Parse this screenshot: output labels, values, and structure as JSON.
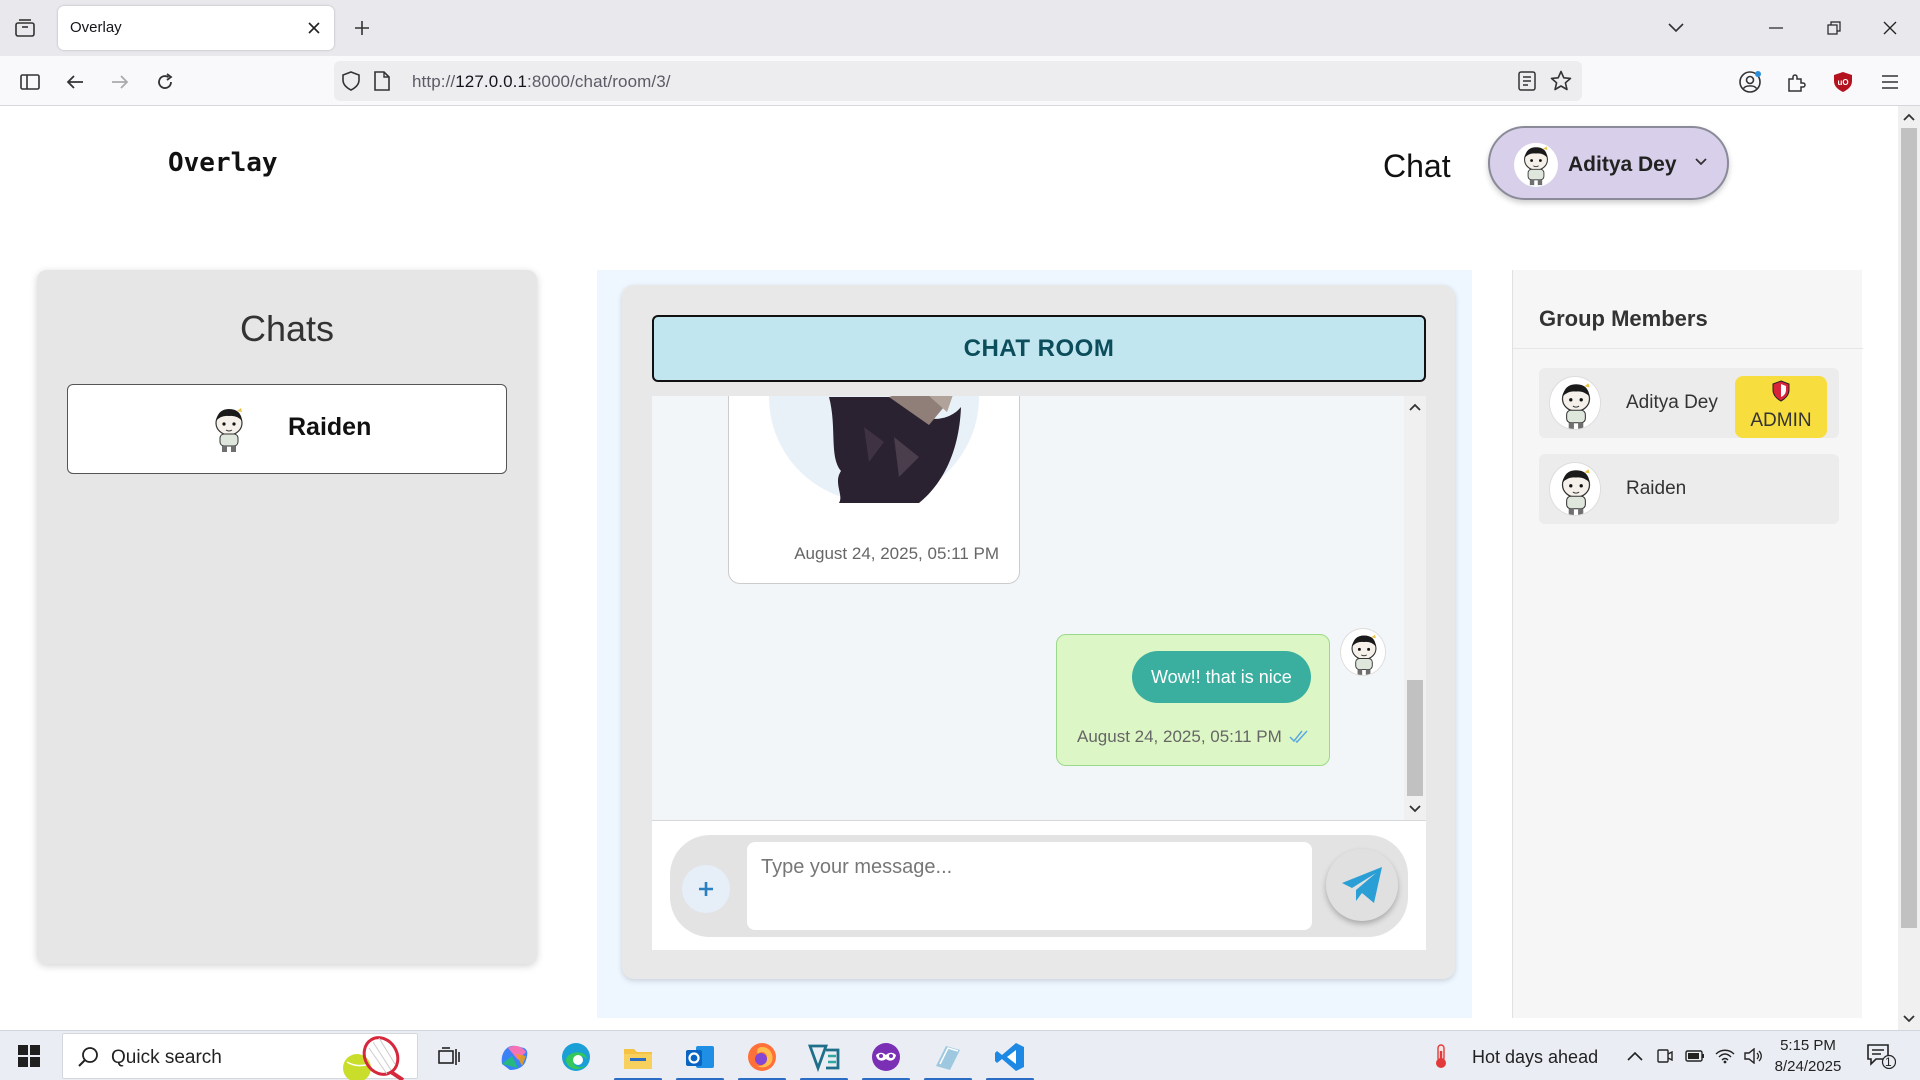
{
  "browser": {
    "tab_title": "Overlay",
    "url_prefix": "http://",
    "url_host": "127.0.0.1",
    "url_path": ":8000/chat/room/3/"
  },
  "header": {
    "logo": "Overlay",
    "nav_chat": "Chat",
    "user_name": "Aditya Dey"
  },
  "chats": {
    "title": "Chats",
    "items": [
      {
        "name": "Raiden"
      }
    ]
  },
  "room": {
    "title": "CHAT ROOM",
    "messages": [
      {
        "type": "image",
        "timestamp": "August 24, 2025, 05:11 PM"
      },
      {
        "type": "text",
        "text": "Wow!! that is nice",
        "timestamp": "August 24, 2025, 05:11 PM",
        "read": true
      }
    ],
    "input_placeholder": "Type your message..."
  },
  "members": {
    "title": "Group Members",
    "list": [
      {
        "name": "Aditya Dey",
        "badge": "ADMIN"
      },
      {
        "name": "Raiden",
        "badge": ""
      }
    ]
  },
  "taskbar": {
    "search_placeholder": "Quick search",
    "weather": "Hot days ahead",
    "time": "5:15 PM",
    "date": "8/24/2025",
    "notification_count": "1"
  },
  "colors": {
    "accent_teal": "#3aafa0",
    "room_header_bg": "#c2e6f0",
    "admin_badge": "#f8dd3e",
    "user_pill": "#d8d0ea",
    "sent_bubble_bg": "#dcf7c5"
  }
}
